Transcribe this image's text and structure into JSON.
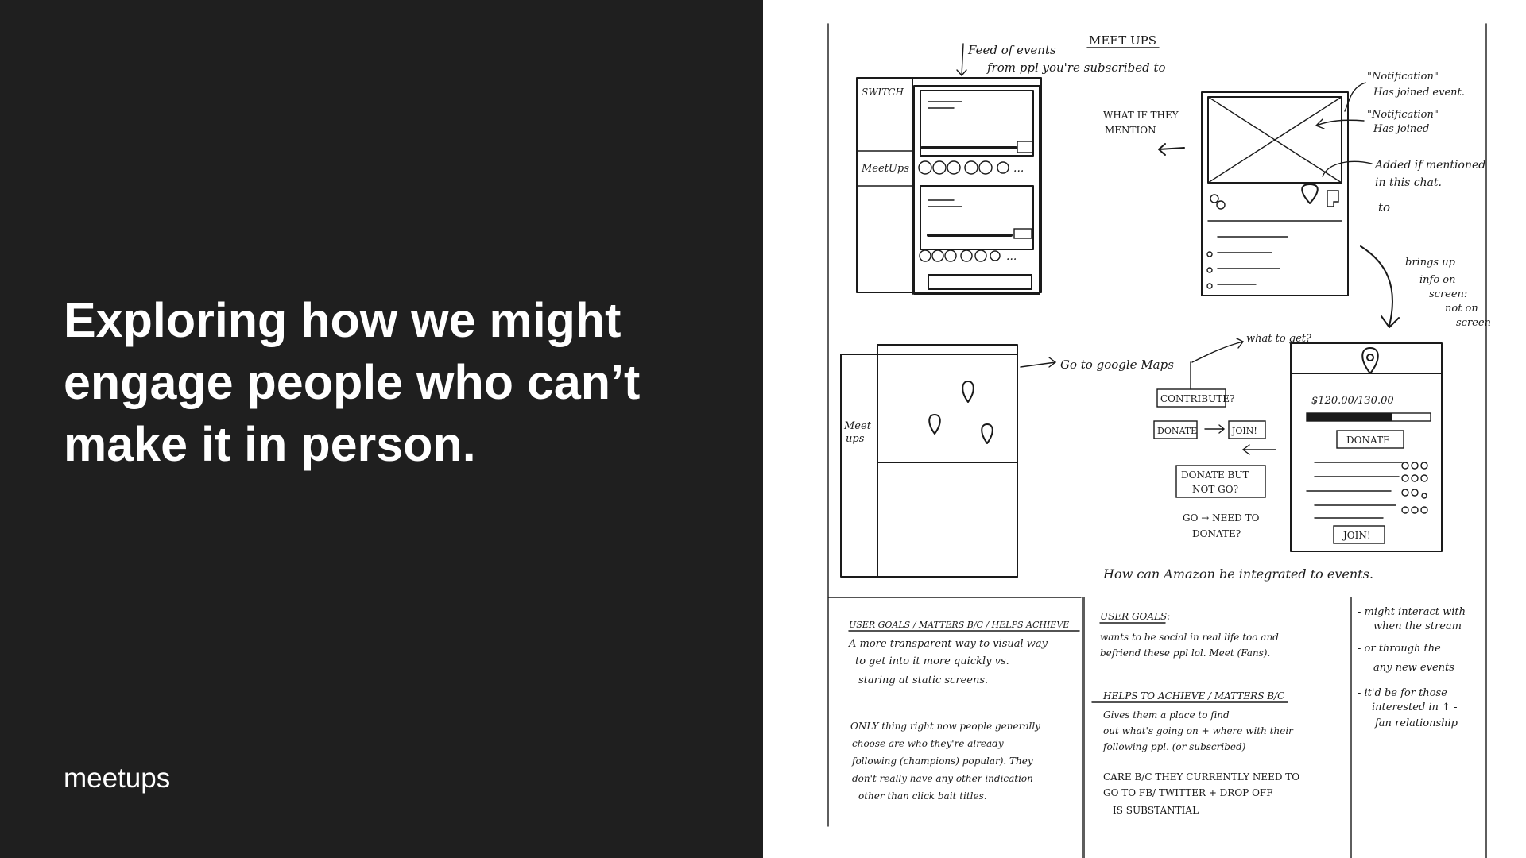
{
  "slide": {
    "headline_lines": [
      "Exploring how we might",
      "engage people who can’t",
      "make it in person."
    ],
    "footer_label": "meetups"
  },
  "sketch": {
    "notes": {
      "title": "MEET UPS",
      "feed": [
        "Feed of events",
        "from ppl you're subscribed to"
      ],
      "switch": "SWITCH",
      "meetups_tab": "MeetUps",
      "what_if": [
        "WHAT IF THEY",
        "MENTION"
      ],
      "notif1": [
        "\"Notification\"",
        "Has joined event."
      ],
      "notif2": [
        "\"Notification\"",
        "Has joined"
      ],
      "added": [
        "Added if mentioned",
        "in this chat."
      ],
      "to": "to",
      "brings": [
        "brings up",
        "info on",
        "screen:",
        "not on",
        "screen"
      ],
      "meetups_tab2": [
        "Meet",
        "ups"
      ],
      "go_maps": "Go to google Maps",
      "what_get": "what to get?",
      "contribute": "CONTRIBUTE?",
      "donate_small": "DONATE",
      "join_small": "JOIN!",
      "donate_not_go": [
        "DONATE BUT",
        "NOT GO?"
      ],
      "go_need": [
        "GO → NEED TO",
        "DONATE?"
      ],
      "amount": "$120.00/130.00",
      "donate_btn": "DONATE",
      "join_btn": "JOIN!",
      "amazon": "How can Amazon be integrated to events.",
      "goals_left_title": "USER GOALS / MATTERS B/C / HELPS ACHIEVE",
      "goals_left": [
        "A more transparent way to visual way",
        "to get into it more quickly vs.",
        "staring at static screens."
      ],
      "only_thing": [
        "ONLY thing right now people generally",
        "choose are who they're already",
        "following (champions) popular). They",
        "don't really have any other indication",
        "other than click bait titles."
      ],
      "goals_mid_title": "USER GOALS:",
      "goals_mid": [
        "wants to be social in real life too and",
        "befriend these ppl lol. Meet (Fans)."
      ],
      "helps_title": "HELPS TO ACHIEVE / MATTERS B/C",
      "helps": [
        "Gives them a place to find",
        "out what's going on + where with their",
        "following ppl. (or subscribed)"
      ],
      "care": [
        "CARE B/C THEY CURRENTLY NEED TO",
        "GO TO FB/ TWITTER + DROP OFF",
        "IS SUBSTANTIAL"
      ],
      "right_col": [
        "- might interact with",
        "when the stream",
        "- or through the",
        "any new events",
        "- it'd be for those",
        "interested in ↑ -",
        "fan relationship",
        "-"
      ]
    }
  }
}
